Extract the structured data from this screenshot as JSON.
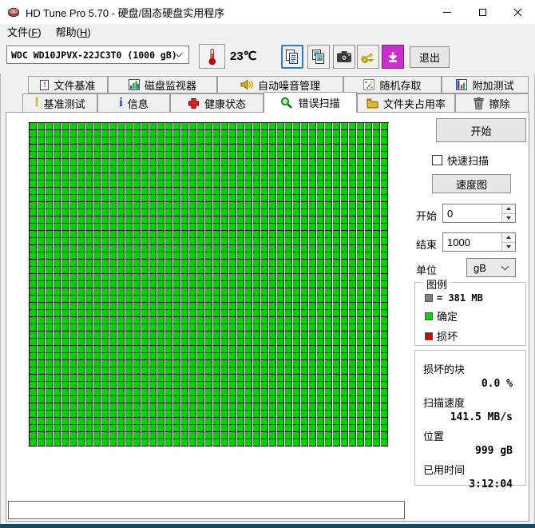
{
  "titlebar": {
    "title": "HD Tune Pro 5.70 - 硬盘/固态硬盘实用程序"
  },
  "menu": {
    "file": {
      "pre": "文件(",
      "key": "F",
      "post": ")"
    },
    "help": {
      "pre": "帮助(",
      "key": "H",
      "post": ")"
    }
  },
  "toolbar": {
    "drive": "WDC WD10JPVX-22JC3T0 (1000 gB)",
    "temperature": "23℃",
    "exit": "退出"
  },
  "tabs": {
    "row1": [
      {
        "label": "文件基准"
      },
      {
        "label": "磁盘监视器"
      },
      {
        "label": "自动噪音管理"
      },
      {
        "label": "随机存取"
      },
      {
        "label": "附加测试"
      }
    ],
    "row2": [
      {
        "label": "基准测试"
      },
      {
        "label": "信息"
      },
      {
        "label": "健康状态"
      },
      {
        "label": "错误扫描",
        "active": true
      },
      {
        "label": "文件夹占用率"
      },
      {
        "label": "擦除"
      }
    ]
  },
  "panel": {
    "start_button": "开始",
    "quick_scan": {
      "label": "快速扫描",
      "checked": false
    },
    "speed_map_button": "速度图",
    "range": {
      "start_label": "开始",
      "start_value": "0",
      "end_label": "结束",
      "end_value": "1000",
      "unit_label": "单位",
      "unit_value": "gB"
    },
    "legend": {
      "title": "图例",
      "block_text": "= 381 MB",
      "block_color": "#808080",
      "ok_label": "确定",
      "ok_color": "#00d400",
      "bad_label": "损坏",
      "bad_color": "#d40000"
    },
    "status": {
      "bad_label": "损坏的块",
      "bad_value": "0.0 %",
      "speed_label": "扫描速度",
      "speed_value": "141.5 MB/s",
      "pos_label": "位置",
      "pos_value": "999 gB",
      "time_label": "已用时间",
      "time_value": "3:12:04"
    }
  },
  "grid": {
    "rows": 45,
    "cols": 45,
    "cell_color": "#00d400",
    "line_color": "#000000"
  }
}
